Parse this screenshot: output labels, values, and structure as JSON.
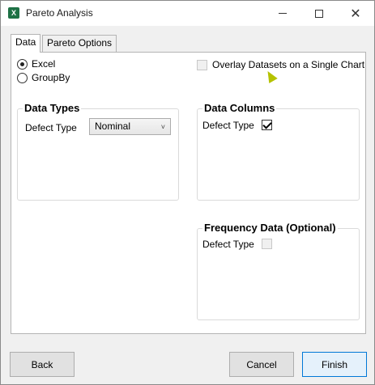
{
  "window": {
    "title": "Pareto Analysis",
    "app_icon": "excel-icon"
  },
  "tabs": [
    {
      "label": "Data",
      "active": true
    },
    {
      "label": "Pareto Options",
      "active": false
    }
  ],
  "source": {
    "options": [
      {
        "label": "Excel",
        "checked": true
      },
      {
        "label": "GroupBy",
        "checked": false
      }
    ]
  },
  "overlay": {
    "label": "Overlay Datasets on a Single Chart",
    "checked": false,
    "enabled": false
  },
  "data_types": {
    "title": "Data Types",
    "field_label": "Defect Type",
    "selected_value": "Nominal"
  },
  "data_columns": {
    "title": "Data Columns",
    "field_label": "Defect Type",
    "checked": true
  },
  "frequency_data": {
    "title": "Frequency Data (Optional)",
    "field_label": "Defect Type",
    "checked": false
  },
  "buttons": {
    "back": "Back",
    "cancel": "Cancel",
    "finish": "Finish"
  }
}
